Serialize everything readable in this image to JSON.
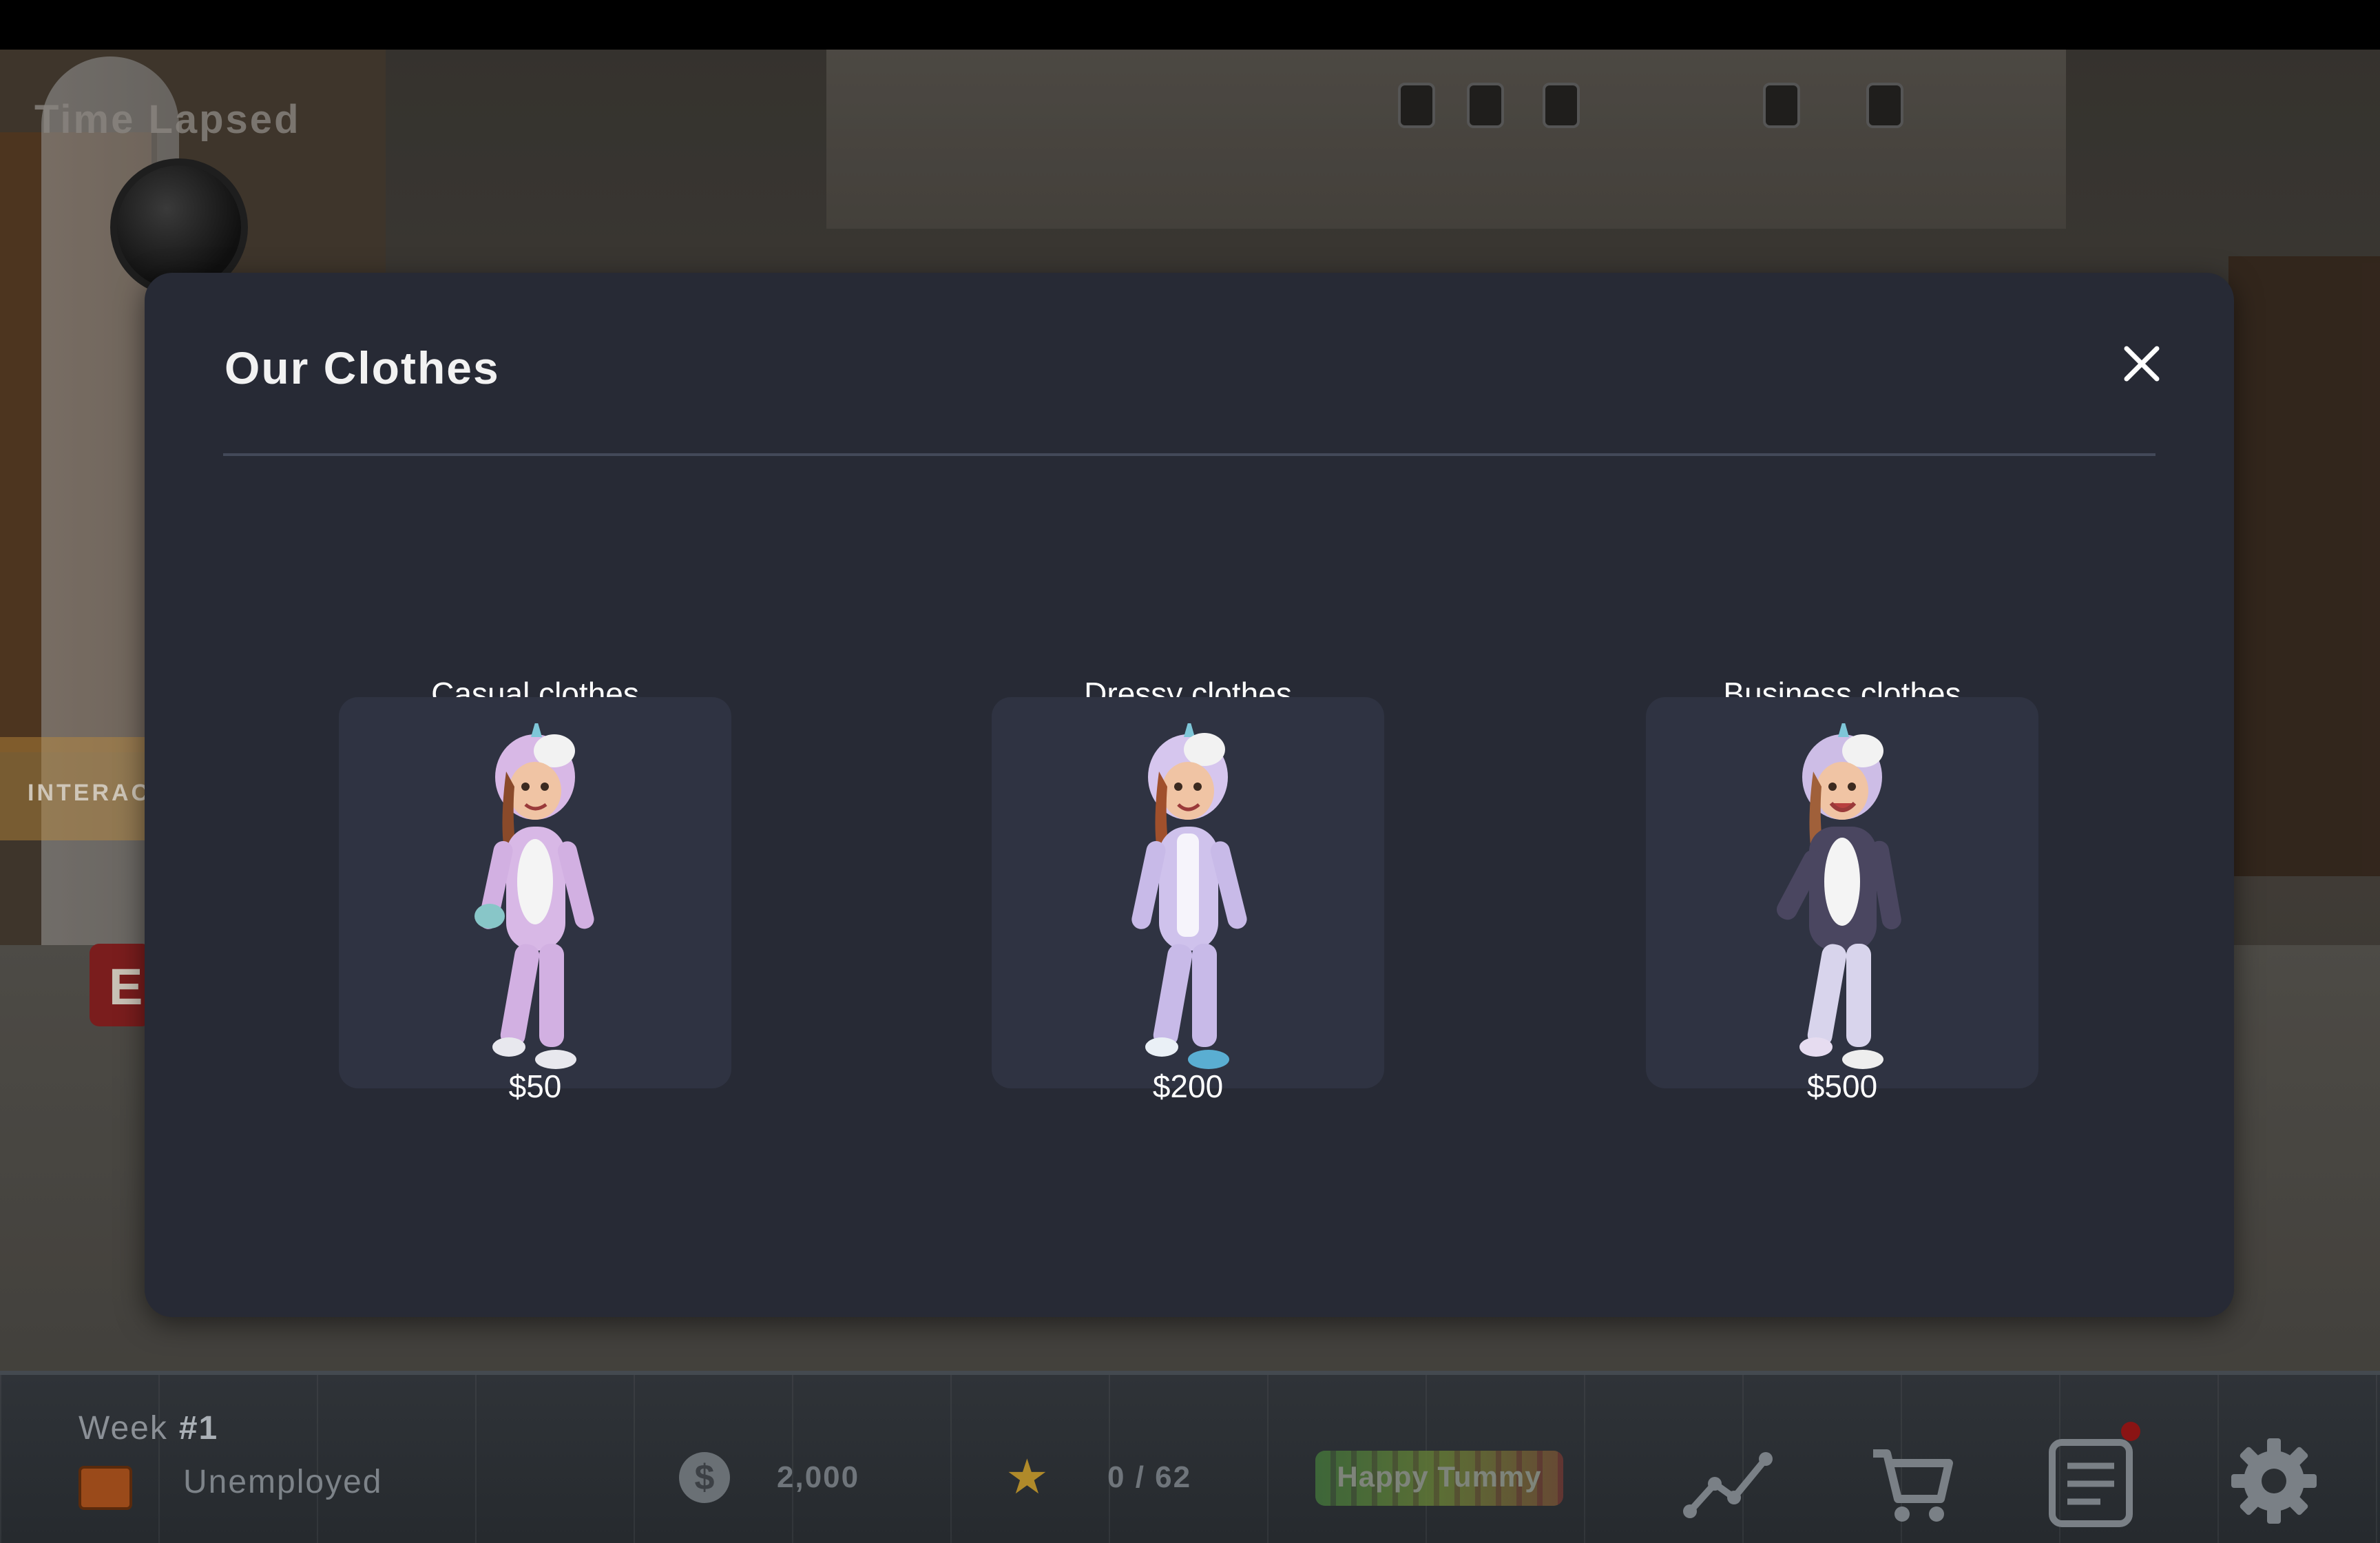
{
  "background": {
    "time_label": "Time Lapsed",
    "interact_label": "INTERAC",
    "exit_letter": "E"
  },
  "modal": {
    "title": "Our Clothes",
    "close_icon": "close-icon",
    "items": [
      {
        "name": "Casual clothes",
        "price": "$50",
        "icon": "unicorn-onesie-casual-icon"
      },
      {
        "name": "Dressy clothes",
        "price": "$200",
        "icon": "unicorn-onesie-dressy-icon"
      },
      {
        "name": "Business clothes",
        "price": "$500",
        "icon": "unicorn-onesie-business-icon"
      }
    ]
  },
  "bottom_bar": {
    "week_label": "Week",
    "week_value": "#1",
    "job_status": "Unemployed",
    "money": "2,000",
    "stars": "0 / 62",
    "tummy_label": "Happy Tummy",
    "icons": [
      "briefcase-icon",
      "dollar-icon",
      "star-icon",
      "stats-icon",
      "cart-icon",
      "tasks-icon",
      "settings-icon"
    ]
  },
  "colors": {
    "modal_bg": "#272a35",
    "card_bg": "#2f3342",
    "divider": "#434959",
    "onesie": "#c9b6e0",
    "notification": "#8a1414"
  }
}
